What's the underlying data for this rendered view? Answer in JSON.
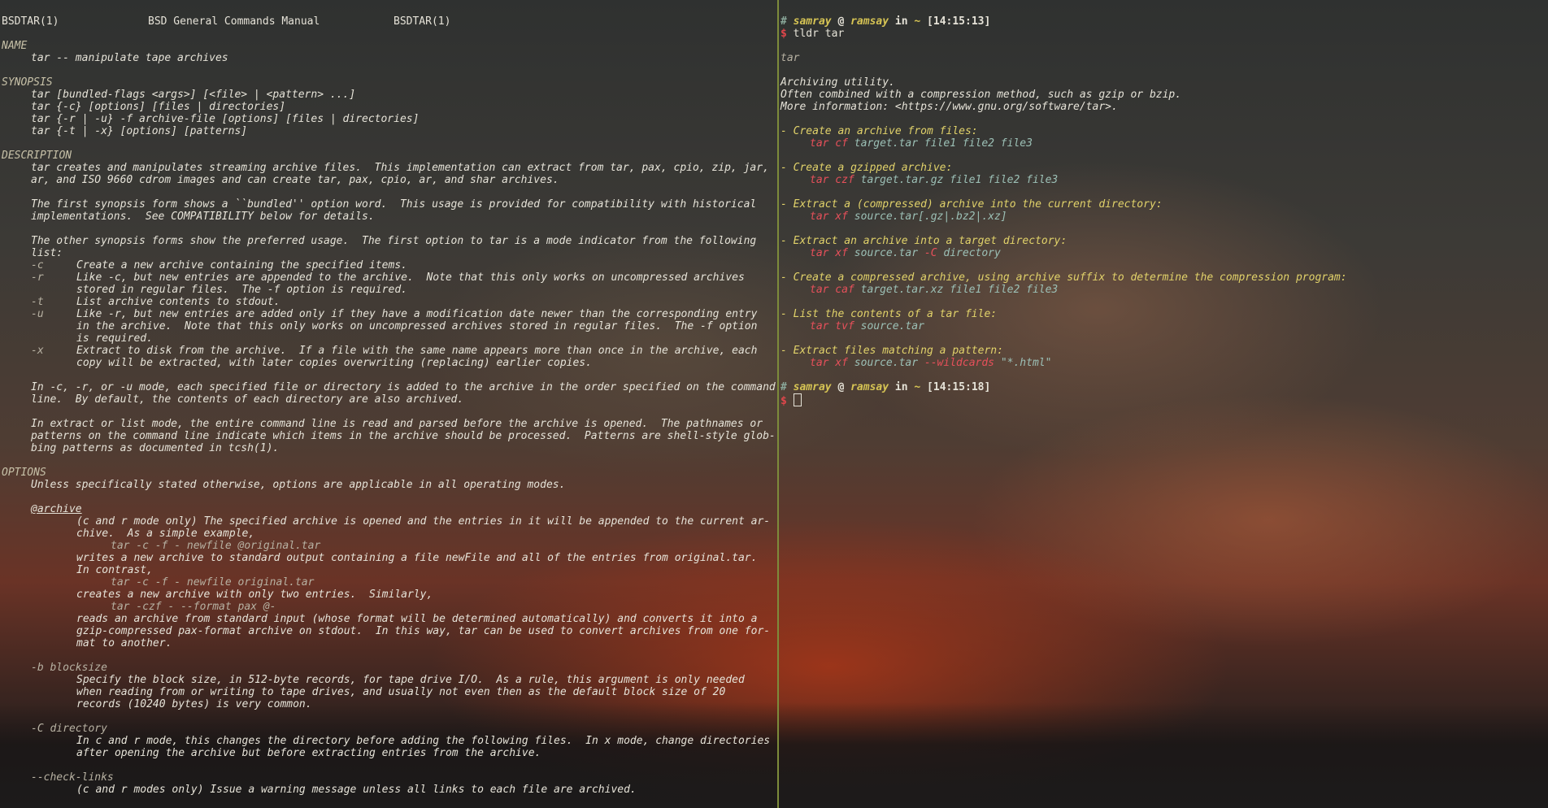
{
  "man": {
    "header": [
      "BSDTAR(1)",
      "BSD General Commands Manual",
      "BSDTAR(1)"
    ],
    "sections": {
      "name": "NAME",
      "synopsis": "SYNOPSIS",
      "description": "DESCRIPTION",
      "options": "OPTIONS"
    },
    "name_line": "tar -- manipulate tape archives",
    "synopsis": [
      "tar [bundled-flags <args>] [<file> | <pattern> ...]",
      "tar {-c} [options] [files | directories]",
      "tar {-r | -u} -f archive-file [options] [files | directories]",
      "tar {-t | -x} [options] [patterns]"
    ],
    "description": [
      "tar creates and manipulates streaming archive files.  This implementation can extract from tar, pax, cpio, zip, jar,",
      "ar, and ISO 9660 cdrom images and can create tar, pax, cpio, ar, and shar archives.",
      "",
      "The first synopsis form shows a ``bundled'' option word.  This usage is provided for compatibility with historical",
      "implementations.  See COMPATIBILITY below for details.",
      "",
      "The other synopsis forms show the preferred usage.  The first option to tar is a mode indicator from the following",
      "list:"
    ],
    "modes": [
      {
        "flag": "-c",
        "lines": [
          "Create a new archive containing the specified items."
        ]
      },
      {
        "flag": "-r",
        "lines": [
          "Like -c, but new entries are appended to the archive.  Note that this only works on uncompressed archives",
          "stored in regular files.  The -f option is required."
        ]
      },
      {
        "flag": "-t",
        "lines": [
          "List archive contents to stdout."
        ]
      },
      {
        "flag": "-u",
        "lines": [
          "Like -r, but new entries are added only if they have a modification date newer than the corresponding entry",
          "in the archive.  Note that this only works on uncompressed archives stored in regular files.  The -f option",
          "is required."
        ]
      },
      {
        "flag": "-x",
        "lines": [
          "Extract to disk from the archive.  If a file with the same name appears more than once in the archive, each",
          "copy will be extracted, with later copies overwriting (replacing) earlier copies."
        ]
      }
    ],
    "description2": [
      "In -c, -r, or -u mode, each specified file or directory is added to the archive in the order specified on the command",
      "line.  By default, the contents of each directory are also archived.",
      "",
      "In extract or list mode, the entire command line is read and parsed before the archive is opened.  The pathnames or",
      "patterns on the command line indicate which items in the archive should be processed.  Patterns are shell-style glob-",
      "bing patterns as documented in tcsh(1)."
    ],
    "options_intro": "Unless specifically stated otherwise, options are applicable in all operating modes.",
    "archive_opt": {
      "name": "@archive",
      "lines": [
        "(c and r mode only) The specified archive is opened and the entries in it will be appended to the current ar-",
        "chive.  As a simple example,"
      ],
      "ex1": "tar -c -f - newfile @original.tar",
      "after1": "writes a new archive to standard output containing a file newFile and all of the entries from original.tar.",
      "after1b": "In contrast,",
      "ex2": "tar -c -f - newfile original.tar",
      "after2": "creates a new archive with only two entries.  Similarly,",
      "ex3": "tar -czf - --format pax @-",
      "after3": [
        "reads an archive from standard input (whose format will be determined automatically) and converts it into a",
        "gzip-compressed pax-format archive on stdout.  In this way, tar can be used to convert archives from one for-",
        "mat to another."
      ]
    },
    "blocksize_opt": {
      "name": "-b blocksize",
      "lines": [
        "Specify the block size, in 512-byte records, for tape drive I/O.  As a rule, this argument is only needed",
        "when reading from or writing to tape drives, and usually not even then as the default block size of 20",
        "records (10240 bytes) is very common."
      ]
    },
    "directory_opt": {
      "name": "-C directory",
      "lines": [
        "In c and r mode, this changes the directory before adding the following files.  In x mode, change directories",
        "after opening the archive but before extracting entries from the archive."
      ]
    },
    "checklinks_opt": {
      "name": "--check-links",
      "lines": [
        "(c and r modes only) Issue a warning message unless all links to each file are archived."
      ]
    }
  },
  "tldr": {
    "prompt1": {
      "hash": "#",
      "user": "samray",
      "at": "@",
      "host": "ramsay",
      "in": "in",
      "dir": "~",
      "time": "[14:15:13]"
    },
    "command": "tldr tar",
    "dollar": "$",
    "title": "tar",
    "desc": [
      "Archiving utility.",
      "Often combined with a compression method, such as gzip or bzip.",
      "More information: <https://www.gnu.org/software/tar>."
    ],
    "examples": [
      {
        "desc": "- Create an archive from files:",
        "cmd": "tar cf",
        "args": "target.tar file1 file2 file3"
      },
      {
        "desc": "- Create a gzipped archive:",
        "cmd": "tar czf",
        "args": "target.tar.gz file1 file2 file3"
      },
      {
        "desc": "- Extract a (compressed) archive into the current directory:",
        "cmd": "tar xf",
        "args": "source.tar[.gz|.bz2|.xz]"
      },
      {
        "desc": "- Extract an archive into a target directory:",
        "cmd": "tar xf",
        "args": "source.tar",
        "cmd2": "-C",
        "args2": "directory"
      },
      {
        "desc": "- Create a compressed archive, using archive suffix to determine the compression program:",
        "cmd": "tar caf",
        "args": "target.tar.xz file1 file2 file3"
      },
      {
        "desc": "- List the contents of a tar file:",
        "cmd": "tar tvf",
        "args": "source.tar"
      },
      {
        "desc": "- Extract files matching a pattern:",
        "cmd": "tar xf",
        "args": "source.tar",
        "cmd2": "--wildcards",
        "args2": "\"*.html\""
      }
    ],
    "prompt2": {
      "hash": "#",
      "user": "samray",
      "at": "@",
      "host": "ramsay",
      "in": "in",
      "dir": "~",
      "time": "[14:15:18]"
    }
  }
}
